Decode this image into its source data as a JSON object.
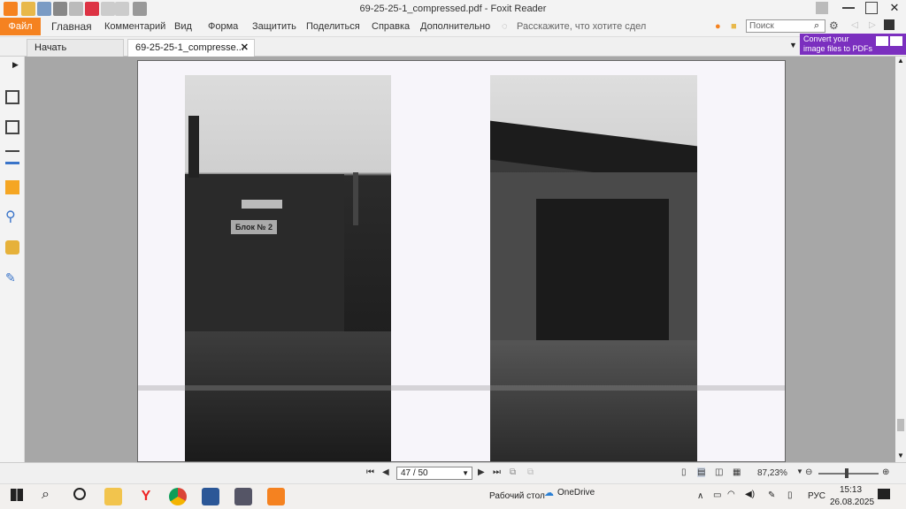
{
  "window": {
    "title": "69-25-25-1_compressed.pdf - Foxit Reader"
  },
  "ribbon": {
    "file": "Файл",
    "menus": [
      "Главная",
      "Комментарий",
      "Вид",
      "Форма",
      "Защитить",
      "Поделиться",
      "Справка",
      "Дополнительно"
    ],
    "tell_me": "Расскажите, что хотите сдел",
    "search_placeholder": "Поиск"
  },
  "tabs": {
    "start": "Начать",
    "doc": "69-25-25-1_compresse..."
  },
  "promo": {
    "line1": "Convert your",
    "line2": "image files to PDFs"
  },
  "statusbar": {
    "page": "47 / 50",
    "zoom": "87,23%"
  },
  "taskbar": {
    "desktop": "Рабочий стол",
    "onedrive": "OneDrive",
    "lang": "РУС",
    "time": "15:13",
    "date": "26.08.2025"
  },
  "document": {
    "sign1": "Блок № 2"
  },
  "colors": {
    "accent": "#f58220",
    "promo": "#7b2fbf"
  }
}
